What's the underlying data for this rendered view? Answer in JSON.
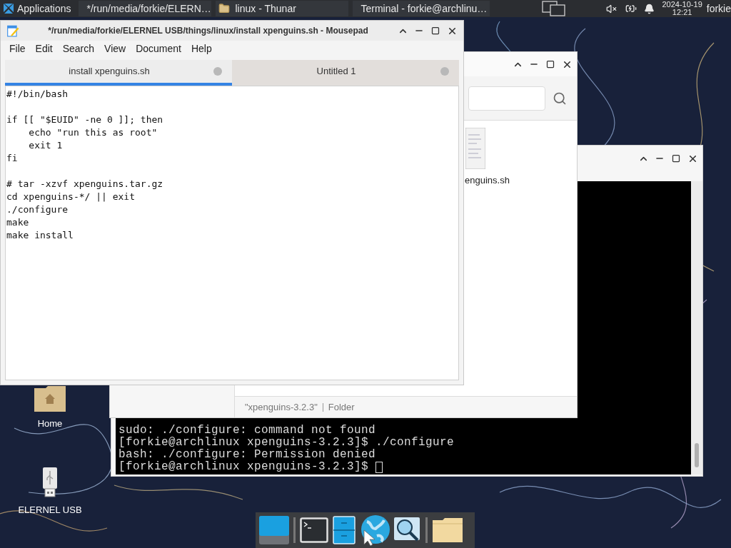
{
  "panel": {
    "menu_label": "Applications",
    "tasks": [
      {
        "kind": "editor",
        "label": "*/run/media/forkie/ELERN…"
      },
      {
        "kind": "folder",
        "label": "linux - Thunar"
      },
      {
        "kind": "terminal",
        "label": "Terminal - forkie@archlinu…"
      }
    ],
    "date": "2024-10-19",
    "time": "12:21",
    "user": "forkie"
  },
  "mousepad": {
    "title": "*/run/media/forkie/ELERNEL USB/things/linux/install xpenguins.sh - Mousepad",
    "menu": [
      "File",
      "Edit",
      "Search",
      "View",
      "Document",
      "Help"
    ],
    "tabs": [
      {
        "label": "install xpenguins.sh",
        "selected": true
      },
      {
        "label": "Untitled 1",
        "selected": false
      }
    ],
    "text": "#!/bin/bash\n\nif [[ \"$EUID\" -ne 0 ]]; then\n    echo \"run this as root\"\n    exit 1\nfi\n\n# tar -xzvf xpenguins.tar.gz\ncd xpenguins-*/ || exit\n./configure\nmake\nmake install"
  },
  "thunar": {
    "file_label": "enguins.sh",
    "status_name": "\"xpenguins-3.2.3\"",
    "status_type": "Folder"
  },
  "terminal": {
    "lines": [
      "sudo: ./configure: command not found",
      "[forkie@archlinux xpenguins-3.2.3]$ ./configure",
      "bash: ./configure: Permission denied",
      "[forkie@archlinux xpenguins-3.2.3]$ "
    ]
  },
  "desktop_icons": [
    {
      "kind": "folder",
      "label": "Home"
    },
    {
      "kind": "usb",
      "label": "ELERNEL USB"
    }
  ]
}
